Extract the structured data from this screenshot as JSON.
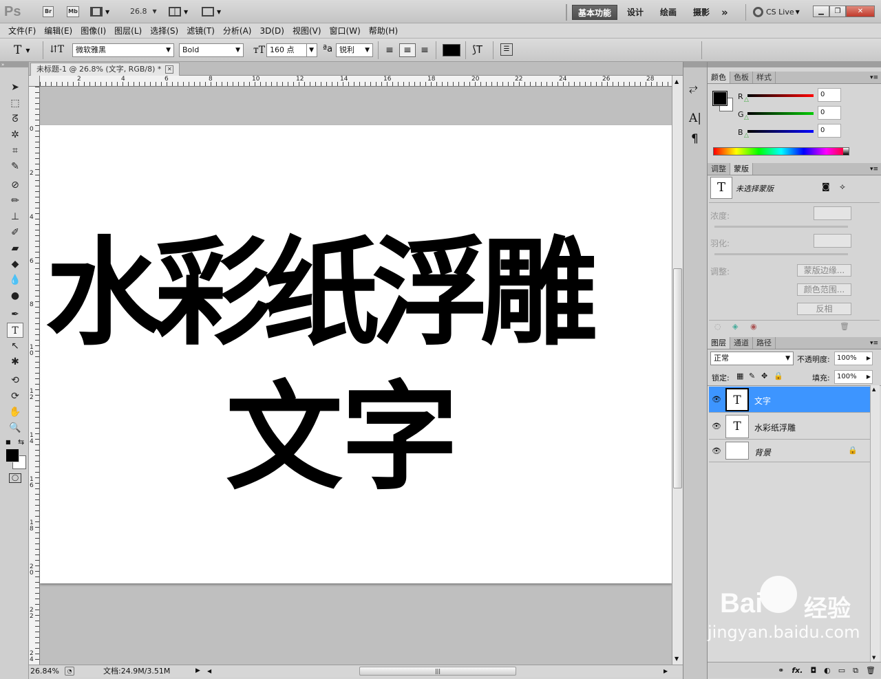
{
  "titlebar": {
    "logo": "Ps",
    "bridge": "Br",
    "minibridge": "Mb",
    "zoom": "26.8",
    "workspaces": [
      "基本功能",
      "设计",
      "绘画",
      "摄影"
    ],
    "more": "»",
    "cs_live": "CS Live"
  },
  "menu": [
    "文件(F)",
    "编辑(E)",
    "图像(I)",
    "图层(L)",
    "选择(S)",
    "滤镜(T)",
    "分析(A)",
    "3D(D)",
    "视图(V)",
    "窗口(W)",
    "帮助(H)"
  ],
  "options": {
    "font_family": "微软雅黑",
    "font_style": "Bold",
    "font_size": "160 点",
    "aa_icon_label": "a",
    "antialias": "锐利",
    "text_color": "#000000"
  },
  "document": {
    "tab_title": "未标题-1 @ 26.8% (文字, RGB/8) *",
    "ruler_top": [
      "2",
      "4",
      "6",
      "8",
      "10",
      "12",
      "14",
      "16",
      "18",
      "20",
      "22",
      "24",
      "26",
      "28"
    ],
    "ruler_left": [
      "0",
      "2",
      "4",
      "6",
      "8",
      "1\n0",
      "1\n2",
      "1\n4",
      "1\n6",
      "1\n8",
      "2\n0",
      "2\n2",
      "2\n4"
    ],
    "line1": "水彩纸浮雕",
    "line2": "文字"
  },
  "statusbar": {
    "zoom": "26.84%",
    "doc_info": "文档:24.9M/3.51M"
  },
  "color_panel": {
    "tabs": [
      "颜色",
      "色板",
      "样式"
    ],
    "r_label": "R",
    "g_label": "G",
    "b_label": "B",
    "r": "0",
    "g": "0",
    "b": "0"
  },
  "masks_panel": {
    "tabs": [
      "调整",
      "蒙版"
    ],
    "status": "未选择蒙版",
    "density_label": "浓度:",
    "feather_label": "羽化:",
    "refine_label": "调整:",
    "mask_edge_btn": "蒙版边缘...",
    "color_range_btn": "颜色范围...",
    "invert_btn": "反相"
  },
  "layers_panel": {
    "tabs": [
      "图层",
      "通道",
      "路径"
    ],
    "blend_mode": "正常",
    "opacity_label": "不透明度:",
    "opacity": "100%",
    "lock_label": "锁定:",
    "fill_label": "填充:",
    "fill": "100%",
    "layers": [
      {
        "name": "文字",
        "thumb": "T",
        "selected": true
      },
      {
        "name": "水彩纸浮雕",
        "thumb": "T",
        "selected": false
      },
      {
        "name": "背景",
        "thumb": "",
        "selected": false
      }
    ]
  },
  "watermark": {
    "brand": "Bai",
    "brand2": "经验",
    "url": "jingyan.baidu.com"
  },
  "colors": {
    "selected_layer": "#3d95ff",
    "canvas": "#ffffff",
    "pasteboard": "#bfbfbf"
  }
}
